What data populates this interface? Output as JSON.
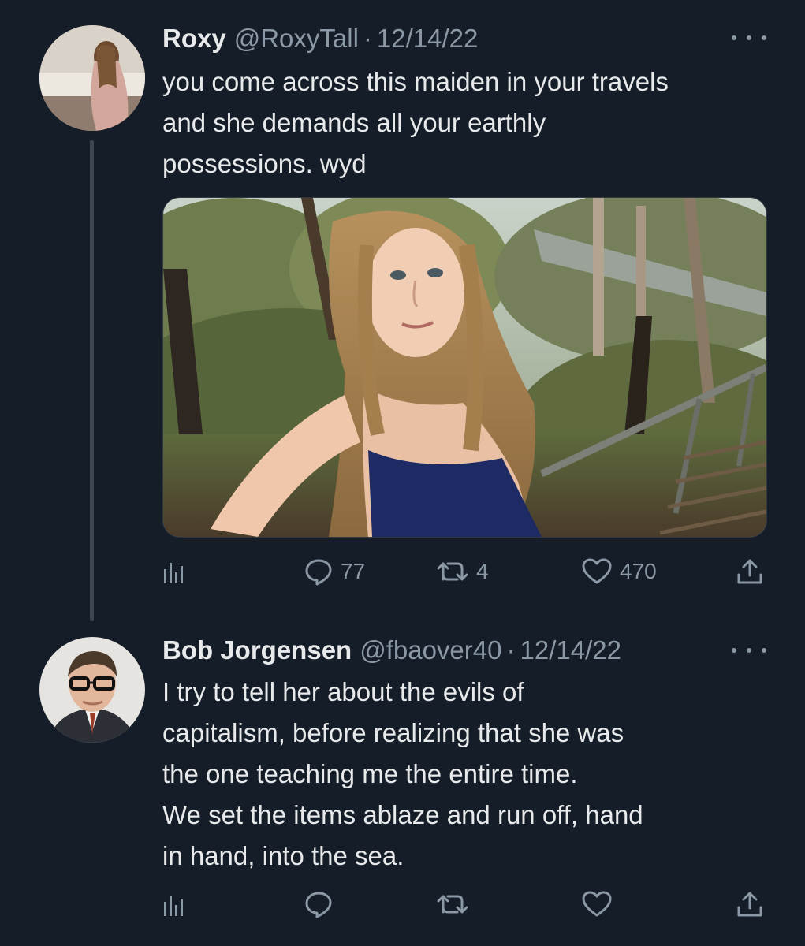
{
  "tweets": [
    {
      "name": "Roxy",
      "handle": "@RoxyTall",
      "separator": "·",
      "date": "12/14/22",
      "text_lines": [
        "you come across this maiden in your travels",
        "and she demands all your earthly",
        "possessions. wyd"
      ],
      "has_media": true,
      "stats": {
        "replies": "77",
        "retweets": "4",
        "likes": "470"
      }
    },
    {
      "name": "Bob Jorgensen",
      "handle": "@fbaover40",
      "separator": "·",
      "date": "12/14/22",
      "text_lines": [
        "I try to tell her about the evils of",
        "capitalism, before realizing that she was",
        "the one teaching me the entire time.",
        "We set the items ablaze and run off, hand",
        "in hand, into the sea."
      ],
      "has_media": false,
      "stats": {
        "replies": "",
        "retweets": "",
        "likes": ""
      }
    }
  ],
  "icons": {
    "views": "bar-chart-icon",
    "reply": "speech-bubble-icon",
    "retweet": "retweet-arrows-icon",
    "like": "heart-icon",
    "share": "share-upload-icon",
    "more": "more-dots-icon"
  },
  "colors": {
    "background": "#151d28",
    "text": "#e7e9ea",
    "secondary": "#8b98a5"
  }
}
